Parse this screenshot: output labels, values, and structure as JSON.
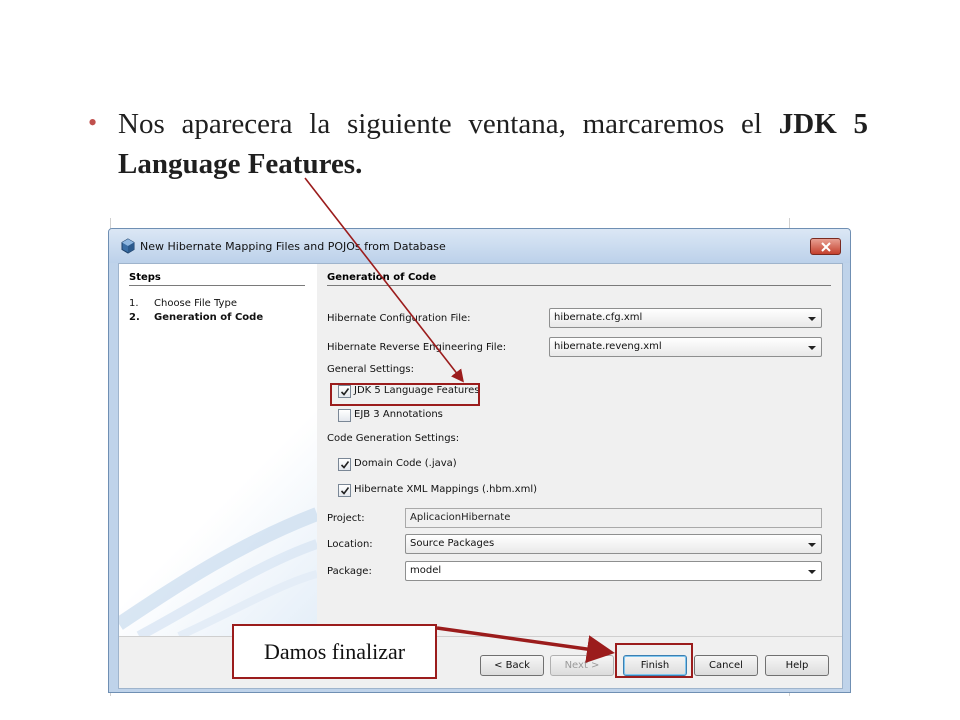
{
  "slide": {
    "bullet": "•",
    "text_before": "Nos aparecera la siguiente ventana, marcaremos el ",
    "text_bold": "JDK 5 Language Features.",
    "callout": "Damos finalizar"
  },
  "dialog": {
    "title": "New Hibernate Mapping Files and POJOs from Database",
    "steps_title": "Steps",
    "steps": [
      {
        "num": "1.",
        "label": "Choose File Type"
      },
      {
        "num": "2.",
        "label": "Generation of Code"
      }
    ],
    "section_title": "Generation of Code",
    "config_file_label": "Hibernate Configuration File:",
    "config_file_value": "hibernate.cfg.xml",
    "reveng_file_label": "Hibernate Reverse Engineering File:",
    "reveng_file_value": "hibernate.reveng.xml",
    "general_settings_label": "General Settings:",
    "jdk5_label": "JDK 5 Language Features",
    "ejb3_label": "EJB 3 Annotations",
    "code_gen_label": "Code Generation Settings:",
    "domain_code_label": "Domain Code (.java)",
    "xml_mappings_label": "Hibernate XML Mappings (.hbm.xml)",
    "project_label": "Project:",
    "project_value": "AplicacionHibernate",
    "location_label": "Location:",
    "location_value": "Source Packages",
    "package_label": "Package:",
    "package_value": "model",
    "buttons": {
      "back": "< Back",
      "next": "Next >",
      "finish": "Finish",
      "cancel": "Cancel",
      "help": "Help"
    },
    "checked": {
      "jdk5": true,
      "ejb3": false,
      "domain_code": true,
      "xml_mappings": true
    }
  },
  "colors": {
    "annotation": "#9b1c1c",
    "bullet": "#c0504d",
    "titlebar": "#bcd1ea"
  }
}
